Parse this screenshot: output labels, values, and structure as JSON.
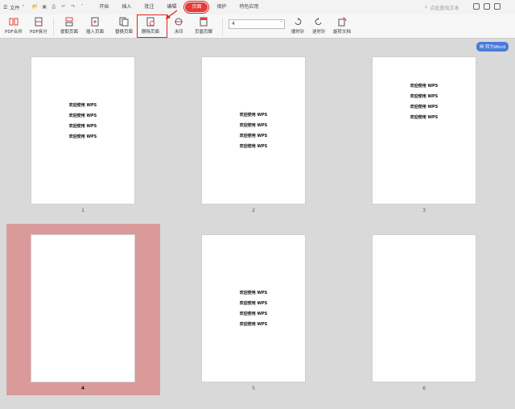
{
  "menubar": {
    "file_label": "文件",
    "tabs": [
      {
        "label": "开始"
      },
      {
        "label": "插入"
      },
      {
        "label": "批注"
      },
      {
        "label": "编辑"
      },
      {
        "label": "页面"
      },
      {
        "label": "保护"
      },
      {
        "label": "特色应用"
      }
    ],
    "search_placeholder": "点此查找文本"
  },
  "ribbon": {
    "pdf_merge": "PDF合并",
    "pdf_split": "PDF拆分",
    "extract_page": "提取页面",
    "insert_page": "插入页面",
    "replace_page": "替换页面",
    "delete_page": "删除页面",
    "watermark": "水印",
    "header_footer": "页眉页脚",
    "page_value": "4",
    "clockwise": "顺时针",
    "counterclockwise": "逆时针",
    "rotate_doc": "旋转文档"
  },
  "to_word": "转为Word",
  "pages": [
    {
      "number": "1",
      "lines": [
        "欢迎使用 WPS",
        "欢迎使用 WPS",
        "欢迎使用 WPS",
        "欢迎使用 WPS"
      ]
    },
    {
      "number": "2",
      "lines": [
        "欢迎使用 WPS",
        "欢迎使用 WPS",
        "欢迎使用 WPS",
        "欢迎使用 WPS"
      ]
    },
    {
      "number": "3",
      "lines": [
        "欢迎使用 WPS",
        "欢迎使用 WPS",
        "欢迎使用 WPS",
        "欢迎使用 WPS"
      ]
    },
    {
      "number": "4",
      "lines": [],
      "selected": true
    },
    {
      "number": "5",
      "lines": [
        "欢迎使用 WPS",
        "欢迎使用 WPS",
        "欢迎使用 WPS",
        "欢迎使用 WPS"
      ]
    },
    {
      "number": "6",
      "lines": []
    }
  ],
  "colors": {
    "accent": "#e53b3b",
    "selection": "#db9a9a",
    "word_button": "#4a7bd8"
  }
}
